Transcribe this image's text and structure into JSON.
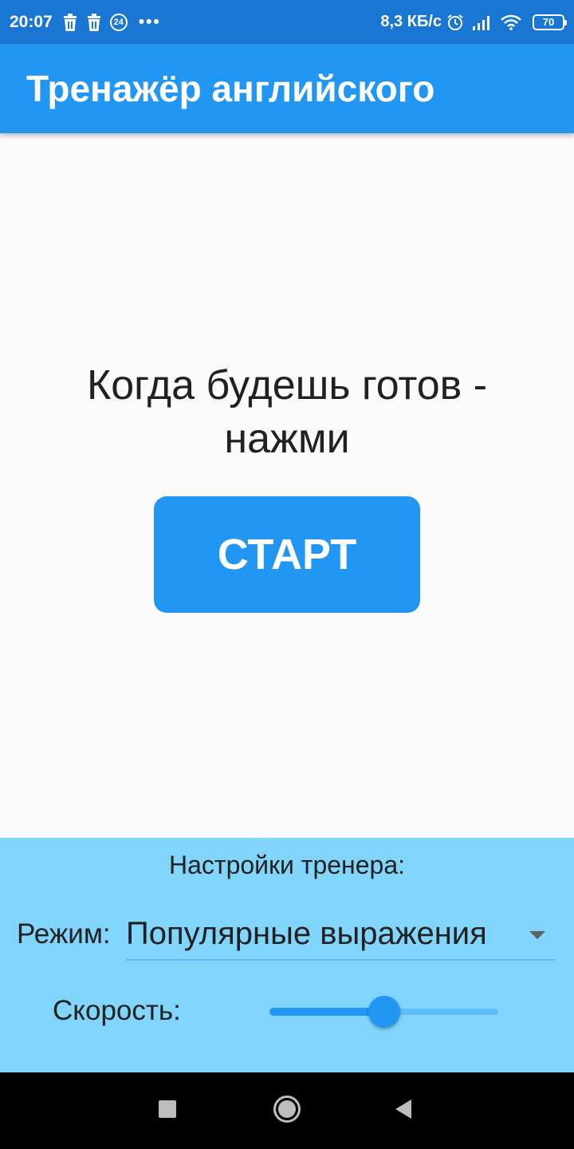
{
  "status_bar": {
    "time": "20:07",
    "notification_badge": "24",
    "more": "•••",
    "net_speed": "8,3 КБ/с",
    "battery": "70",
    "icons": [
      "trash-icon",
      "trash-icon",
      "badge-24-icon",
      "more-dots-icon",
      "alarm-icon",
      "signal-icon",
      "wifi-icon",
      "battery-icon"
    ]
  },
  "app_bar": {
    "title": "Тренажёр английского"
  },
  "main": {
    "prompt": "Когда будешь готов - нажми",
    "start_label": "СТАРТ"
  },
  "settings": {
    "title": "Настройки тренера:",
    "mode_label": "Режим:",
    "mode_value": "Популярные выражения",
    "speed_label": "Скорость:",
    "speed_value": 0.5
  },
  "nav_bar": {
    "icons": [
      "recents-square-icon",
      "home-circle-icon",
      "back-triangle-icon"
    ]
  },
  "colors": {
    "status_bar": "#1976d2",
    "app_bar": "#2196f3",
    "primary": "#2196f3",
    "settings_bg": "#81d4fa",
    "background": "#fafafa",
    "nav_bar": "#000000"
  }
}
